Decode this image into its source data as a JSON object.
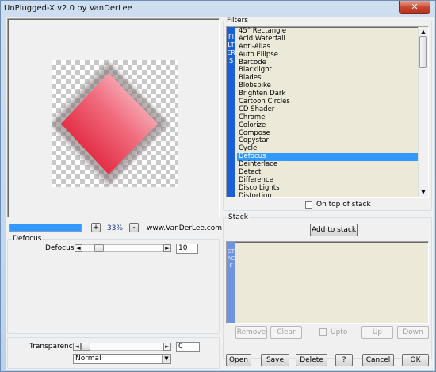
{
  "window": {
    "title": "UnPlugged-X v2.0 by VanDerLee",
    "close_glyph": "✕"
  },
  "preview": {
    "zoom_minus": "-",
    "zoom_plus": "+",
    "zoom_value": "33%",
    "website": "www.VanDerLee.com",
    "progress": 1.0
  },
  "defocus_group": {
    "label": "Defocus",
    "param_label": "Defocus",
    "param_value": "10",
    "slider_level": 0.17
  },
  "transparency": {
    "label": "Transparency",
    "value": "0",
    "slider_level": 0.0,
    "blend_mode": "Normal"
  },
  "filters": {
    "label": "Filters",
    "side_label": "FILTERS",
    "items": [
      "45° Rectangle",
      "Acid Waterfall",
      "Anti-Alias",
      "Auto Ellipse",
      "Barcode",
      "Blacklight",
      "Blades",
      "Blobspike",
      "Brighten Dark",
      "Cartoon Circles",
      "CD Shader",
      "Chrome",
      "Colorize",
      "Compose",
      "Copystar",
      "Cycle",
      "Defocus",
      "Deinterlace",
      "Detect",
      "Difference",
      "Disco Lights",
      "Distortion"
    ],
    "selected": "Defocus",
    "on_top_label": "On top of stack"
  },
  "stack": {
    "label": "Stack",
    "side_label": "STACK",
    "add_label": "Add to stack",
    "remove_label": "Remove",
    "clear_label": "Clear",
    "upto_label": "Upto",
    "up_label": "Up",
    "down_label": "Down"
  },
  "buttons": {
    "open": "Open",
    "save": "Save",
    "delete": "Delete",
    "help": "?",
    "cancel": "Cancel",
    "ok": "OK"
  },
  "colors": {
    "accent": "#3399ff",
    "progress": "#3399ff",
    "side_bar": "#1b5fd6",
    "stack_bar": "#6f93e0",
    "list_bg": "#ece9d8"
  }
}
